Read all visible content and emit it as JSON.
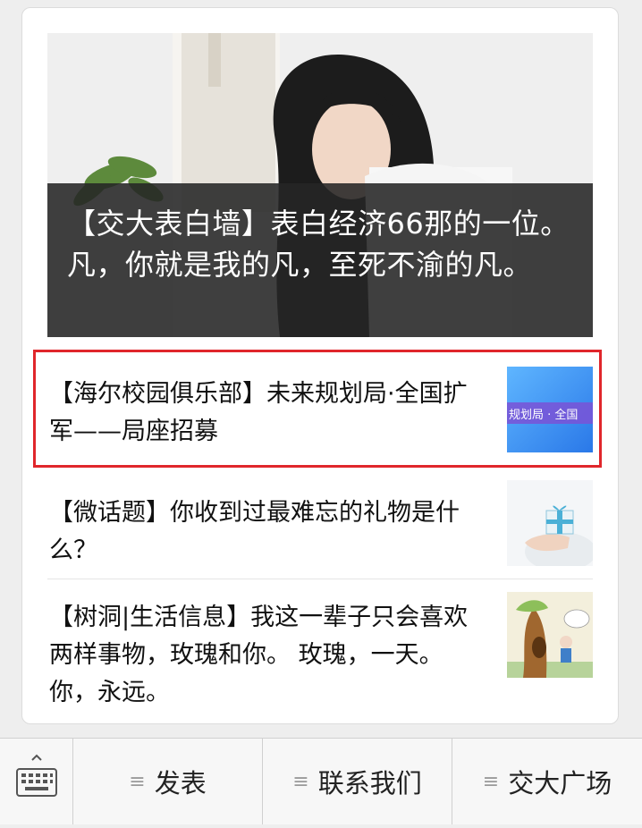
{
  "hero": {
    "title": "【交大表白墙】表白经济66那的一位。凡，你就是我的凡，至死不渝的凡。"
  },
  "articles": [
    {
      "title": "【海尔校园俱乐部】未来规划局·全国扩军——局座招募",
      "thumb_text": "规划局 · 全国"
    },
    {
      "title": "【微话题】你收到过最难忘的礼物是什么？"
    },
    {
      "title": "【树洞|生活信息】我这一辈子只会喜欢两样事物，玫瑰和你。 玫瑰，一天。 你，永远。"
    }
  ],
  "menu": {
    "items": [
      {
        "label": "发表"
      },
      {
        "label": "联系我们"
      },
      {
        "label": "交大广场"
      }
    ]
  },
  "colors": {
    "highlight": "#e0262b",
    "caption_bg": "#262626"
  }
}
